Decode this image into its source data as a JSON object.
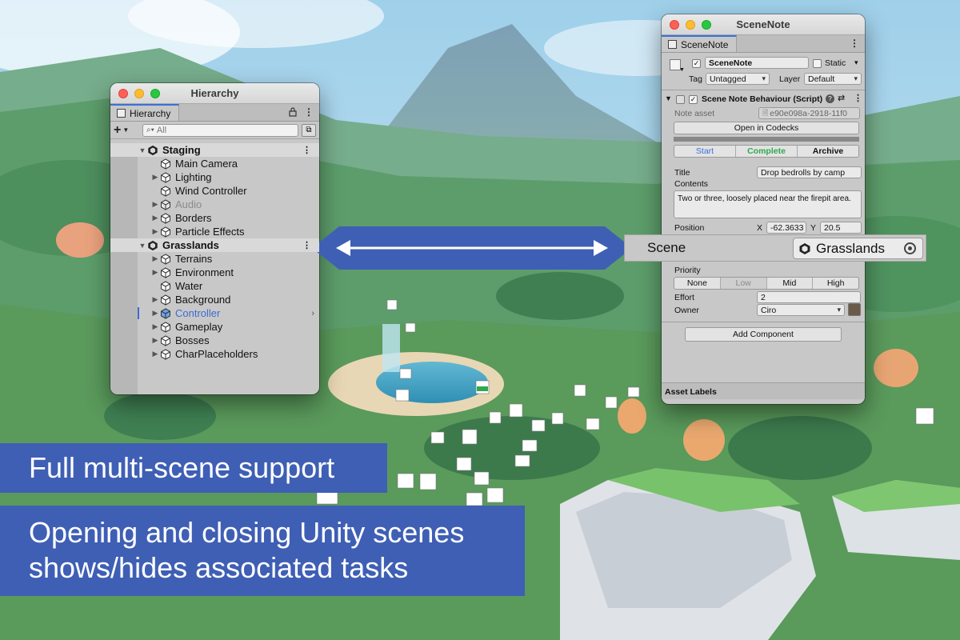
{
  "hierarchy": {
    "window_title": "Hierarchy",
    "tab_label": "Hierarchy",
    "search_placeholder": "All",
    "rows": [
      {
        "label": "Staging",
        "scene": true,
        "expanded": true
      },
      {
        "label": "Main Camera",
        "arrow": false
      },
      {
        "label": "Lighting",
        "arrow": true
      },
      {
        "label": "Wind Controller",
        "arrow": false
      },
      {
        "label": "Audio",
        "arrow": true,
        "dim": true
      },
      {
        "label": "Borders",
        "arrow": true
      },
      {
        "label": "Particle Effects",
        "arrow": true
      },
      {
        "label": "Grasslands",
        "scene": true,
        "expanded": true
      },
      {
        "label": "Terrains",
        "arrow": true
      },
      {
        "label": "Environment",
        "arrow": true
      },
      {
        "label": "Water",
        "arrow": false
      },
      {
        "label": "Background",
        "arrow": true
      },
      {
        "label": "Controller",
        "arrow": true,
        "blue": true,
        "chevron": true
      },
      {
        "label": "Gameplay",
        "arrow": true
      },
      {
        "label": "Bosses",
        "arrow": true
      },
      {
        "label": "CharPlaceholders",
        "arrow": true
      }
    ]
  },
  "inspector": {
    "window_title": "SceneNote",
    "tab_label": "SceneNote",
    "object_name": "SceneNote",
    "static_label": "Static",
    "tag_label": "Tag",
    "tag_value": "Untagged",
    "layer_label": "Layer",
    "layer_value": "Default",
    "component_title": "Scene Note Behaviour (Script)",
    "note_asset_label": "Note asset",
    "note_asset_value": "e90e098a-2918-11f0",
    "open_button": "Open in Codecks",
    "status_buttons": [
      "Start",
      "Complete",
      "Archive"
    ],
    "title_label": "Title",
    "title_value": "Drop bedrolls by camp",
    "contents_label": "Contents",
    "contents_value": "Two or three, loosely placed near the firepit area.",
    "position_label": "Position",
    "pos_x_label": "X",
    "pos_x_value": "-62.3633",
    "pos_y_label": "Y",
    "pos_y_value": "20.5",
    "priority_label": "Priority",
    "priority_options": [
      "None",
      "Low",
      "Mid",
      "High"
    ],
    "effort_label": "Effort",
    "effort_value": "2",
    "owner_label": "Owner",
    "owner_value": "Ciro",
    "add_component": "Add Component",
    "asset_labels": "Asset Labels",
    "colors": {
      "start": "#3c6fd6",
      "complete": "#2fa84f"
    }
  },
  "scene_bar": {
    "label": "Scene",
    "value": "Grasslands"
  },
  "captions": {
    "line1": "Full multi-scene support",
    "line2a": "Opening and closing Unity scenes",
    "line2b": "shows/hides associated tasks"
  },
  "icons": [
    "unity-scene-icon",
    "gameobject-cube-icon",
    "lock-icon",
    "kebab-menu-icon",
    "search-icon",
    "double-arrow-icon",
    "target-icon",
    "help-icon",
    "settings-sliders-icon"
  ]
}
